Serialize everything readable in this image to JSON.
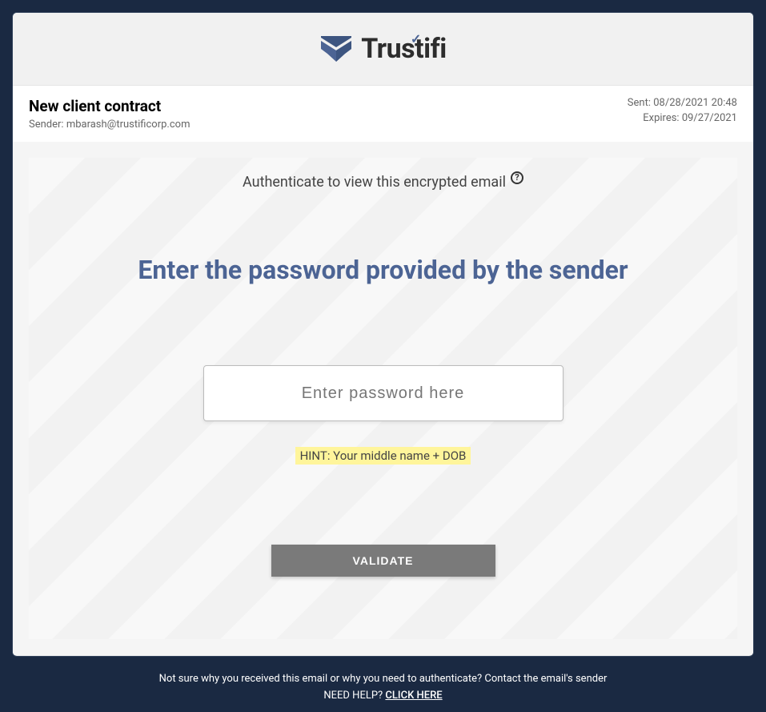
{
  "brand": {
    "name": "Trustifi"
  },
  "meta": {
    "subject": "New client contract",
    "sender_label": "Sender:",
    "sender_email": "mbarash@trustificorp.com",
    "sent_label": "Sent:",
    "sent_value": "08/28/2021 20:48",
    "expires_label": "Expires:",
    "expires_value": "09/27/2021"
  },
  "content": {
    "authenticate_text": "Authenticate to view this encrypted email",
    "help_icon": "?",
    "heading": "Enter the password provided by the sender",
    "password_placeholder": "Enter password here",
    "hint": "HINT: Your middle name + DOB",
    "validate_button": "VALIDATE"
  },
  "footer": {
    "text": "Not sure why you received this email or why you need to authenticate? Contact the email's sender",
    "help_prefix": "NEED HELP?",
    "help_link": "CLICK HERE"
  }
}
